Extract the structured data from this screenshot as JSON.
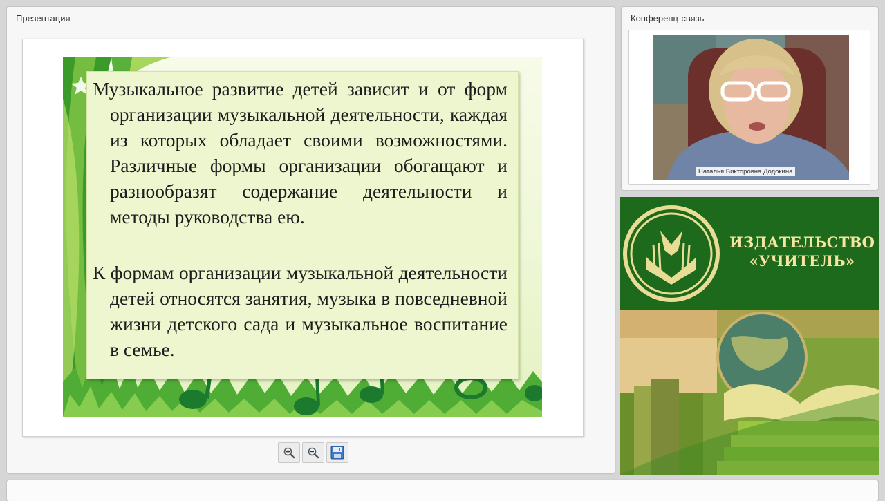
{
  "presentation_panel": {
    "title": "Презентация",
    "slide": {
      "paragraph_1": "Музыкальное развитие детей зависит и от форм организации музыкальной деятельности, каждая из которых обладает своими возможностями. Различные формы организации обогащают и разнообразят содержание деятельности и методы руководства ею.",
      "paragraph_2": "К формам организации музыкальной деятельности детей относятся занятия, музыка в повседневной жизни детского сада и музыкальное воспитание в семье."
    },
    "tools": [
      "zoom-in-icon",
      "zoom-out-icon",
      "save-icon"
    ]
  },
  "conference_panel": {
    "title": "Конференц-связь",
    "participant_name": "Наталья Викторовна Додокина"
  },
  "ad": {
    "title_line_1": "ИЗДАТЕЛЬСТВО",
    "title_line_2": "«УЧИТЕЛЬ»"
  },
  "colors": {
    "panel_background": "#f7f7f7",
    "ad_green": "#1e6a1c",
    "ad_gold": "#f4e6a1",
    "slide_green": "#3da02d"
  }
}
